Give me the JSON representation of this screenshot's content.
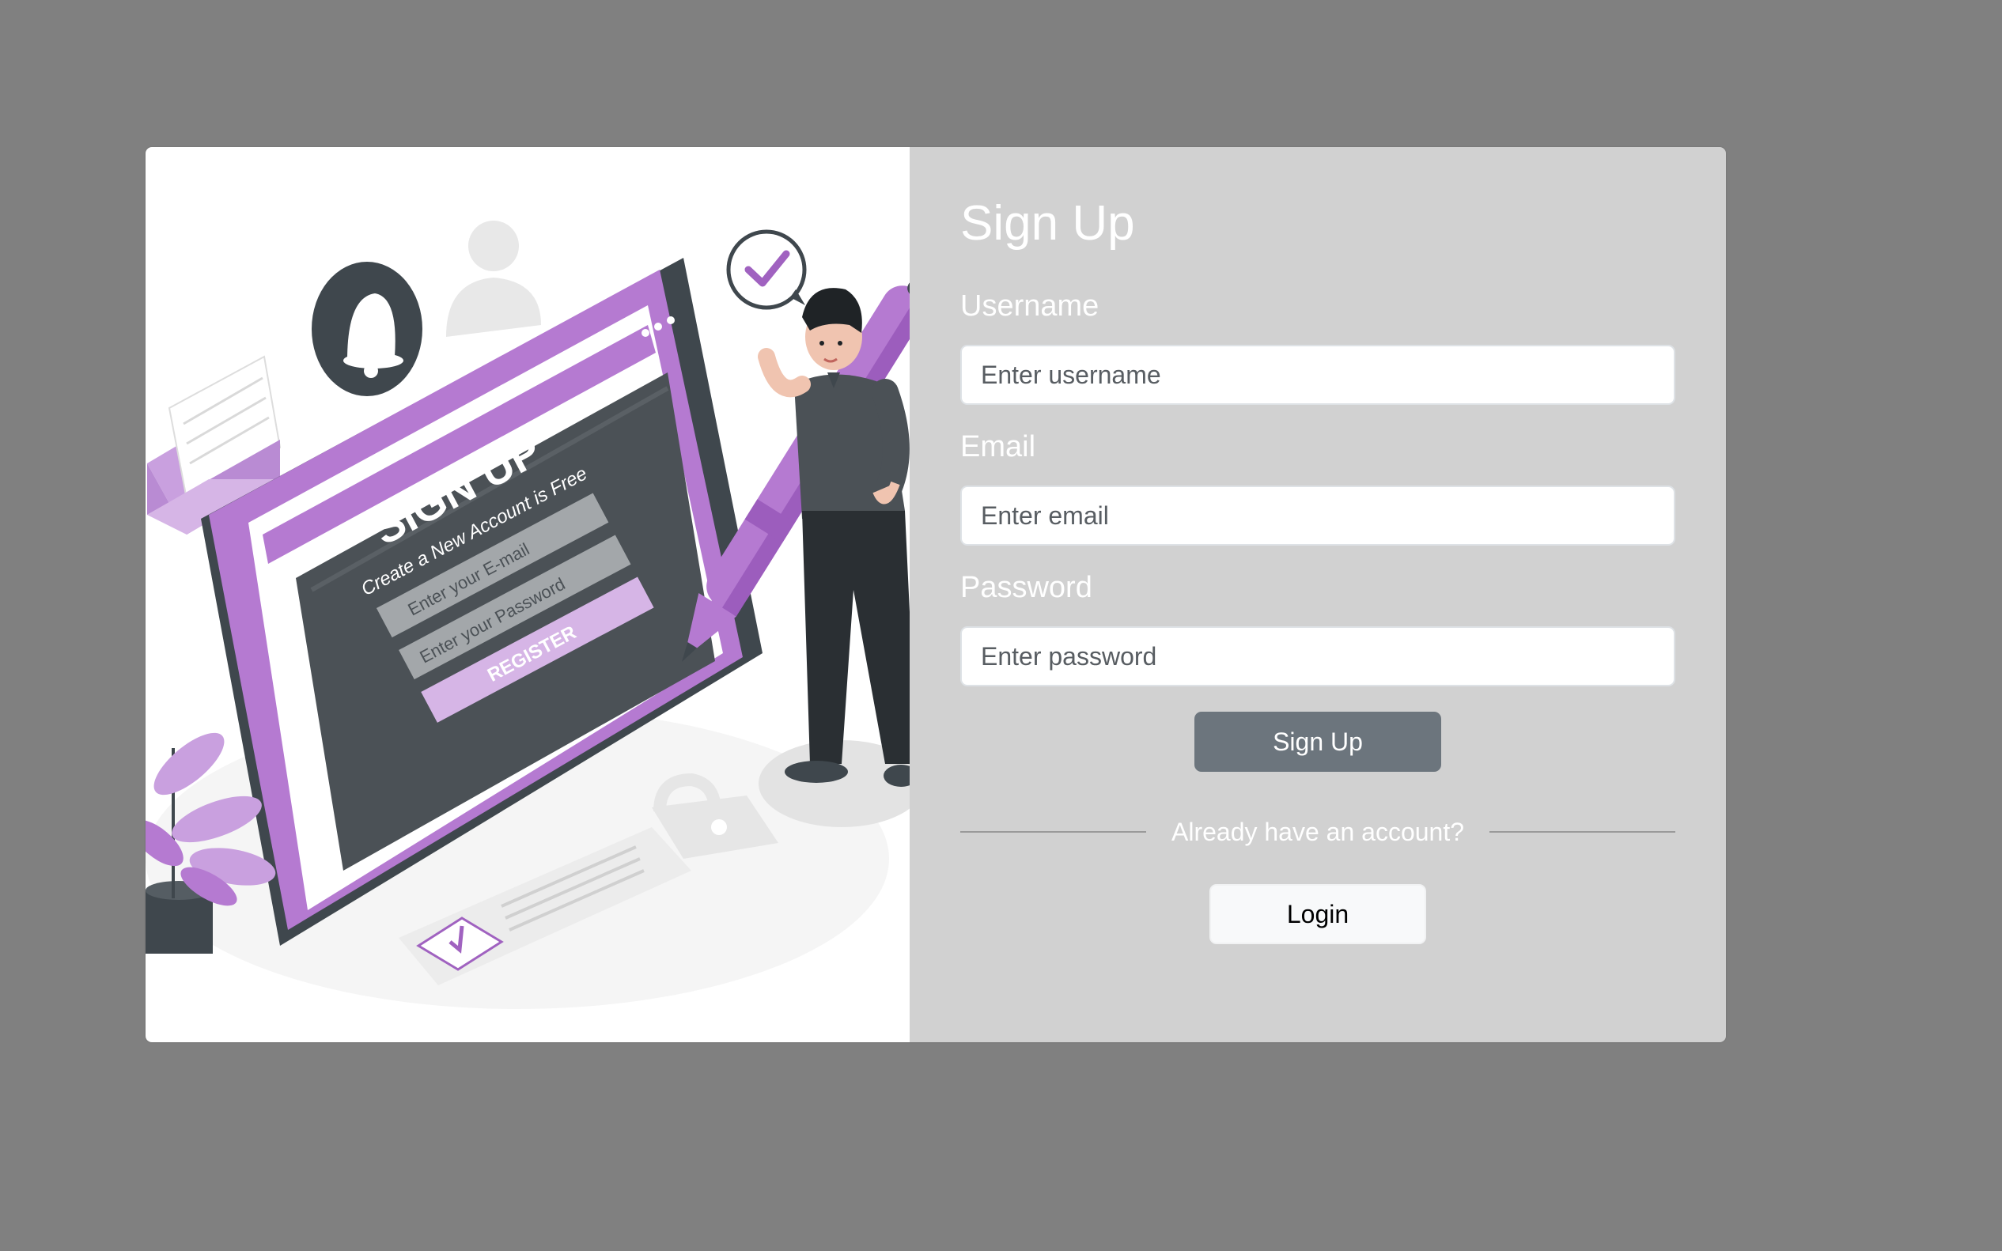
{
  "illustration": {
    "heading": "SIGN UP",
    "subheading": "Create a New Account is Free",
    "email_field": "Enter your E-mail",
    "password_field": "Enter your Password",
    "register_button": "REGISTER",
    "accent_color": "#b57ad1"
  },
  "form": {
    "title": "Sign Up",
    "username_label": "Username",
    "username_placeholder": "Enter username",
    "email_label": "Email",
    "email_placeholder": "Enter email",
    "password_label": "Password",
    "password_placeholder": "Enter password",
    "submit_label": "Sign Up",
    "divider_text": "Already have an account?",
    "login_label": "Login"
  },
  "colors": {
    "backdrop": "#808080",
    "panel": "#d1d1d1",
    "primary_button": "#6c757d",
    "light_button": "#f8f9fa"
  }
}
